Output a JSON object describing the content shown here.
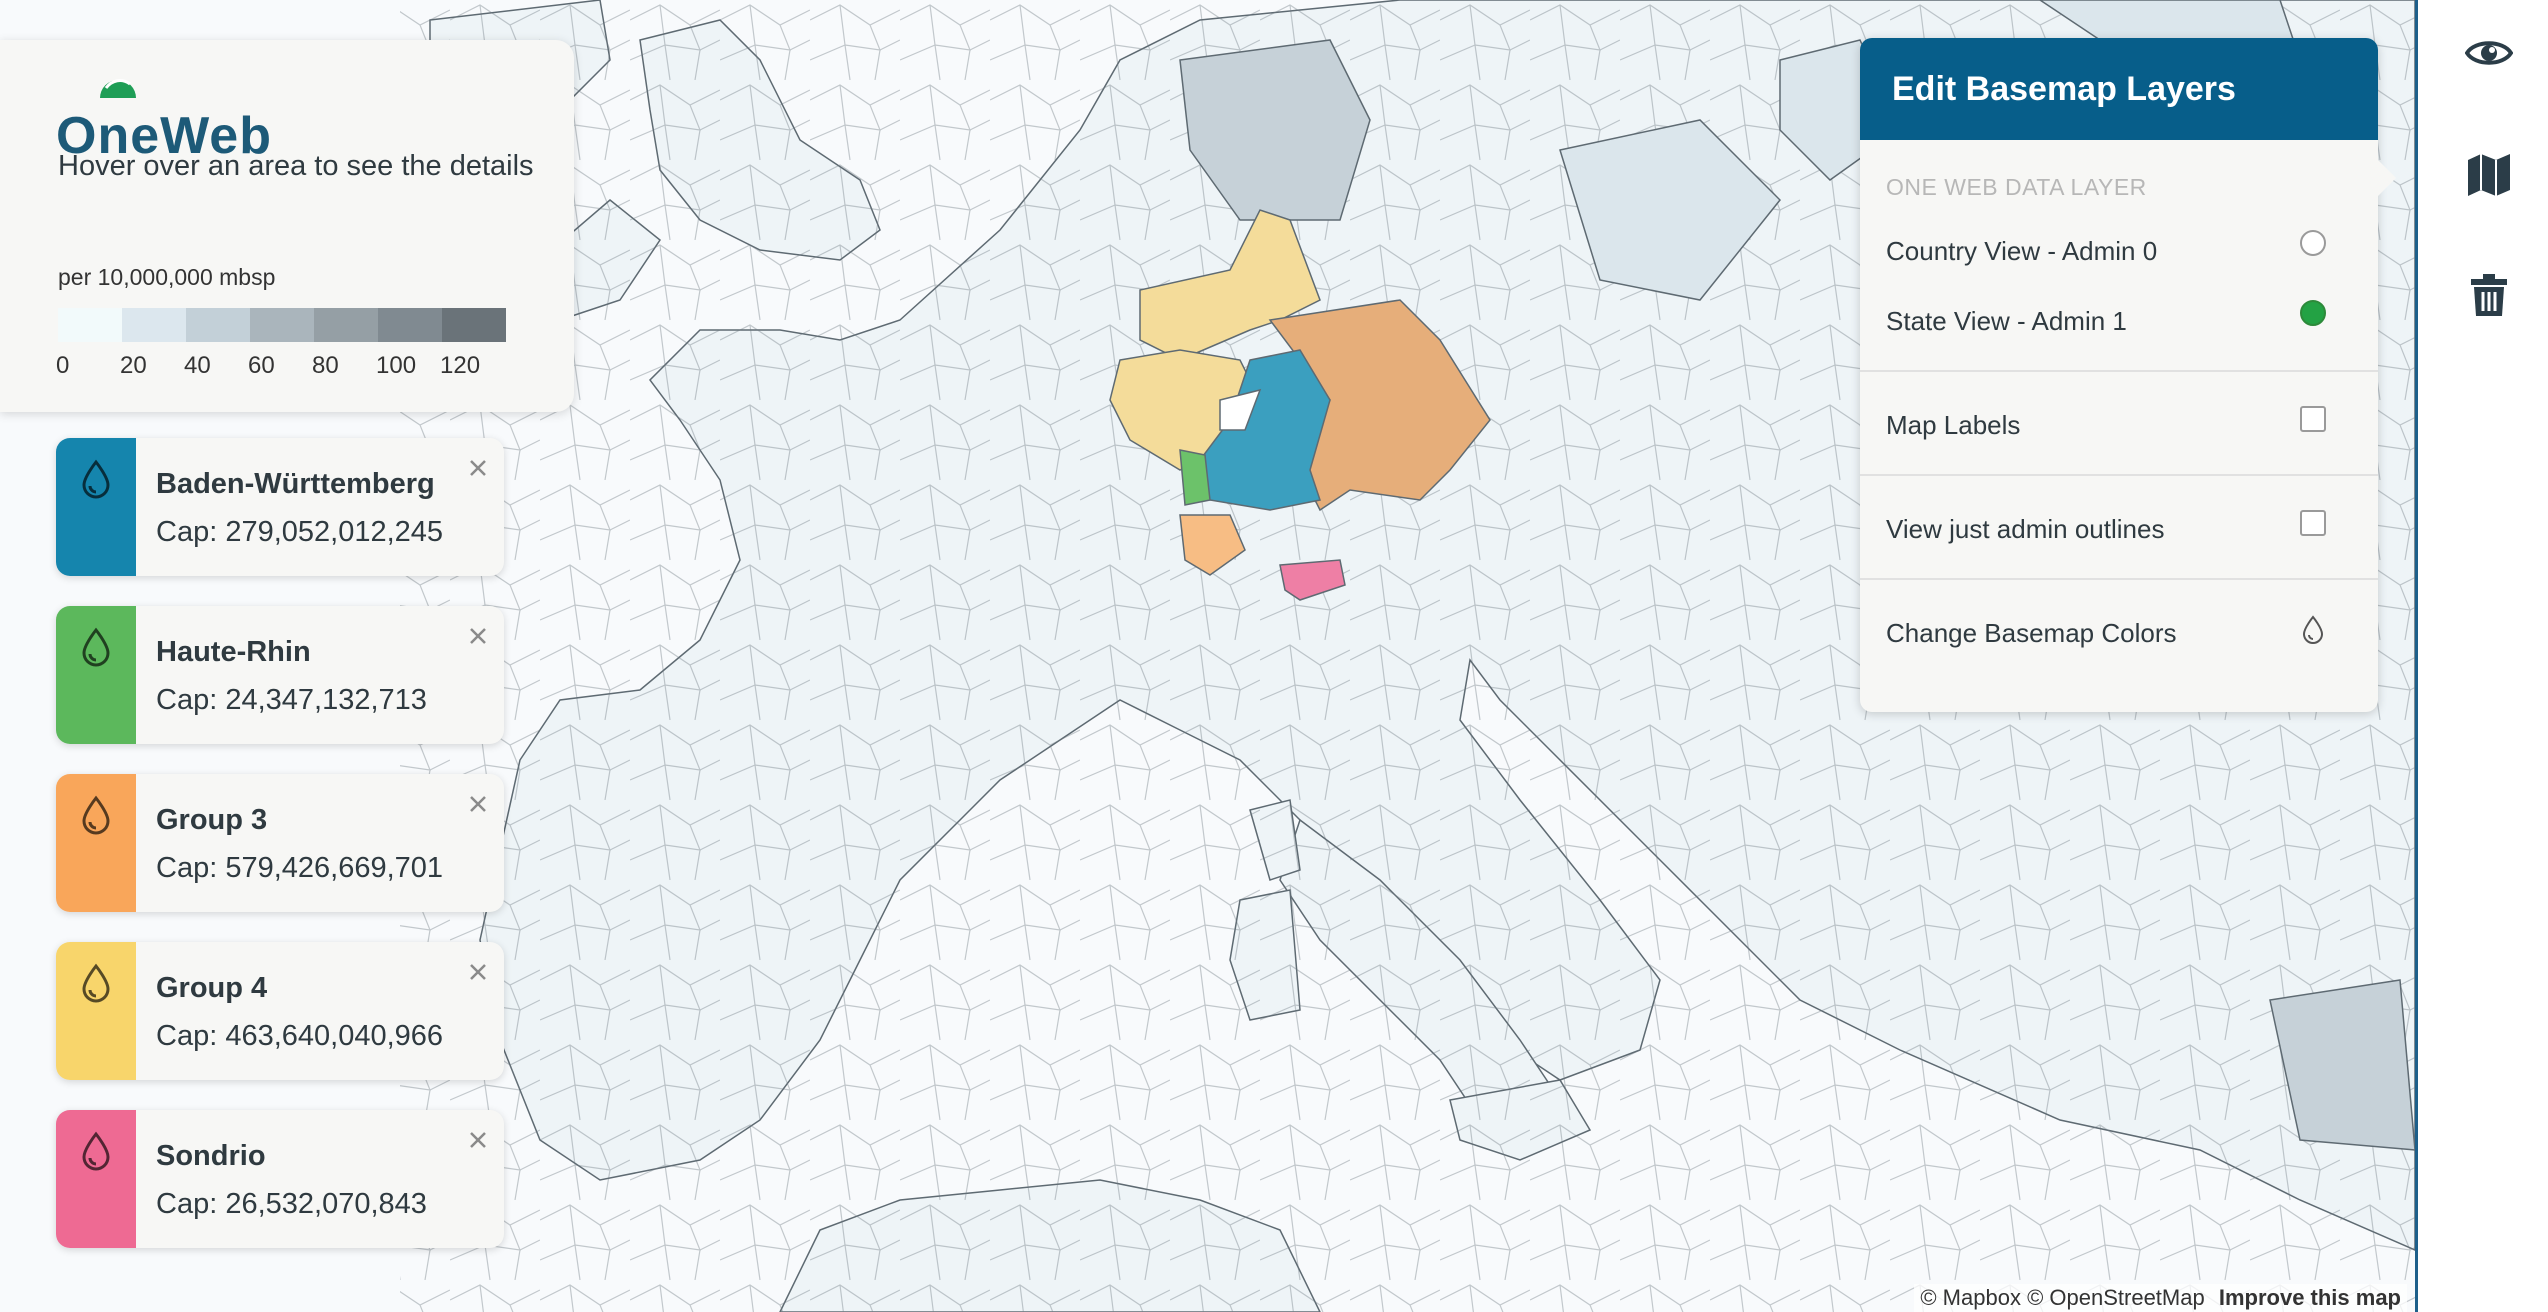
{
  "app": {
    "logo_text": "OneWeb",
    "hover_hint": "Hover over an area to see the details"
  },
  "legend": {
    "units": "per 10,000,000 mbsp",
    "ticks": [
      "0",
      "20",
      "40",
      "60",
      "80",
      "100",
      "120"
    ],
    "colors": [
      "#f2fafb",
      "#dce7ee",
      "#c3d0d8",
      "#aab5bc",
      "#959fa5",
      "#808a91",
      "#6a7379"
    ]
  },
  "selections": [
    {
      "name": "Baden-Württemberg",
      "cap": "Cap: 279,052,012,245",
      "color": "#1585ad"
    },
    {
      "name": "Haute-Rhin",
      "cap": "Cap: 24,347,132,713",
      "color": "#5cb85c"
    },
    {
      "name": "Group 3",
      "cap": "Cap: 579,426,669,701",
      "color": "#f9a65a"
    },
    {
      "name": "Group 4",
      "cap": "Cap: 463,640,040,966",
      "color": "#f8d56b"
    },
    {
      "name": "Sondrio",
      "cap": "Cap: 26,532,070,843",
      "color": "#ee6a93"
    }
  ],
  "layers_panel": {
    "title": "Edit Basemap Layers",
    "section_label": "ONE WEB DATA LAYER",
    "country_view": "Country View - Admin 0",
    "state_view": "State View - Admin 1",
    "selected_view": "State View - Admin 1",
    "map_labels": "Map Labels",
    "map_labels_checked": false,
    "admin_outlines": "View just admin outlines",
    "admin_outlines_checked": false,
    "change_colors": "Change Basemap Colors"
  },
  "toolbar": {
    "icons": [
      "eye-icon",
      "map-icon",
      "trash-icon"
    ]
  },
  "attribution": {
    "mapbox": "© Mapbox",
    "osm": "© OpenStreetMap",
    "improve": "Improve this map"
  },
  "colors": {
    "header_blue": "#075e8a",
    "accent_green": "#23a244",
    "bavaria": "#e6ae7a",
    "germany_yellow": "#f4dc9a"
  }
}
